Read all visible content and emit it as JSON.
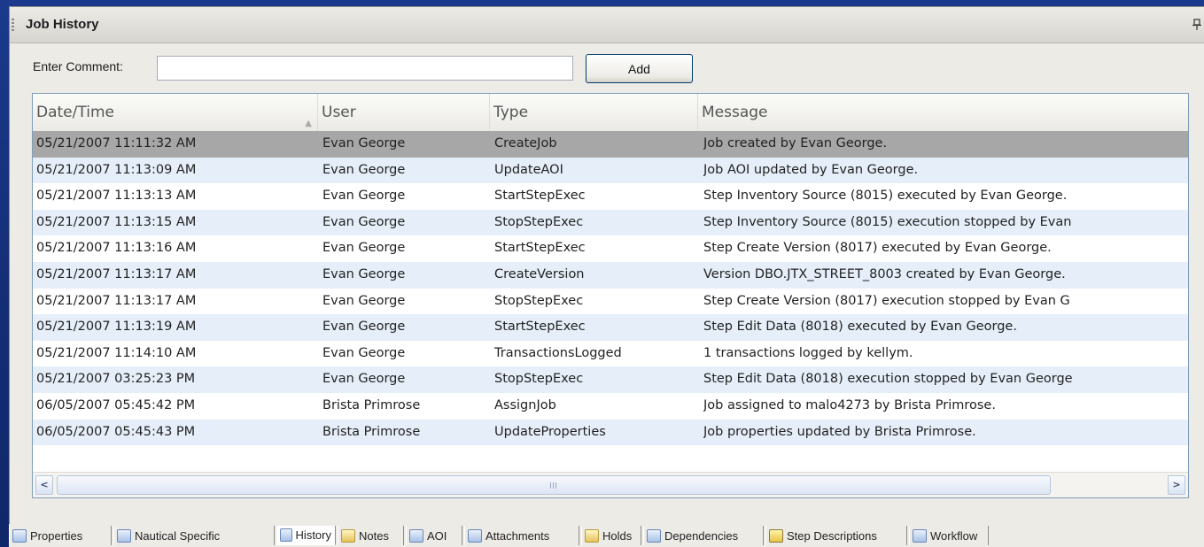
{
  "panel": {
    "title": "Job History"
  },
  "comment": {
    "label": "Enter Comment:",
    "value": "",
    "placeholder": "",
    "add_label": "Add"
  },
  "grid": {
    "columns": [
      "Date/Time",
      "User",
      "Type",
      "Message"
    ],
    "rows": [
      {
        "date": "05/21/2007 11:11:32 AM",
        "user": "Evan George",
        "type": "CreateJob",
        "message": "Job created by Evan George.",
        "selected": true
      },
      {
        "date": "05/21/2007 11:13:09 AM",
        "user": "Evan George",
        "type": "UpdateAOI",
        "message": "Job AOI updated by Evan George."
      },
      {
        "date": "05/21/2007 11:13:13 AM",
        "user": "Evan George",
        "type": "StartStepExec",
        "message": "Step Inventory Source (8015) executed by Evan George."
      },
      {
        "date": "05/21/2007 11:13:15 AM",
        "user": "Evan George",
        "type": "StopStepExec",
        "message": "Step Inventory Source (8015) execution stopped by Evan"
      },
      {
        "date": "05/21/2007 11:13:16 AM",
        "user": "Evan George",
        "type": "StartStepExec",
        "message": "Step Create Version (8017) executed by Evan George."
      },
      {
        "date": "05/21/2007 11:13:17 AM",
        "user": "Evan George",
        "type": "CreateVersion",
        "message": "Version DBO.JTX_STREET_8003 created by Evan George."
      },
      {
        "date": "05/21/2007 11:13:17 AM",
        "user": "Evan George",
        "type": "StopStepExec",
        "message": "Step Create Version (8017) execution stopped by Evan G"
      },
      {
        "date": "05/21/2007 11:13:19 AM",
        "user": "Evan George",
        "type": "StartStepExec",
        "message": "Step Edit Data (8018) executed by Evan George."
      },
      {
        "date": "05/21/2007 11:14:10 AM",
        "user": "Evan George",
        "type": "TransactionsLogged",
        "message": "1 transactions logged by kellym."
      },
      {
        "date": "05/21/2007 03:25:23 PM",
        "user": "Evan George",
        "type": "StopStepExec",
        "message": "Step Edit Data (8018) execution stopped by Evan George"
      },
      {
        "date": "06/05/2007 05:45:42 PM",
        "user": "Brista Primrose",
        "type": "AssignJob",
        "message": "Job assigned to malo4273 by Brista Primrose."
      },
      {
        "date": "06/05/2007 05:45:43 PM",
        "user": "Brista Primrose",
        "type": "UpdateProperties",
        "message": "Job properties updated by Brista Primrose."
      }
    ]
  },
  "tabs": [
    {
      "label": "Properties",
      "icon": "properties-icon"
    },
    {
      "label": "Nautical Specific",
      "icon": "nautical-icon"
    },
    {
      "label": "History",
      "icon": "history-icon",
      "active": true
    },
    {
      "label": "Notes",
      "icon": "notes-icon"
    },
    {
      "label": "AOI",
      "icon": "aoi-icon"
    },
    {
      "label": "Attachments",
      "icon": "attachments-icon"
    },
    {
      "label": "Holds",
      "icon": "holds-icon"
    },
    {
      "label": "Dependencies",
      "icon": "dependencies-icon"
    },
    {
      "label": "Step Descriptions",
      "icon": "step-descriptions-icon"
    },
    {
      "label": "Workflow",
      "icon": "workflow-icon"
    }
  ],
  "colors": {
    "background": "#16307a",
    "panel": "#ecebe6",
    "selected_row": "#a7a7a7",
    "alt_row": "#e6eff9",
    "grid_border": "#7f9db9"
  }
}
